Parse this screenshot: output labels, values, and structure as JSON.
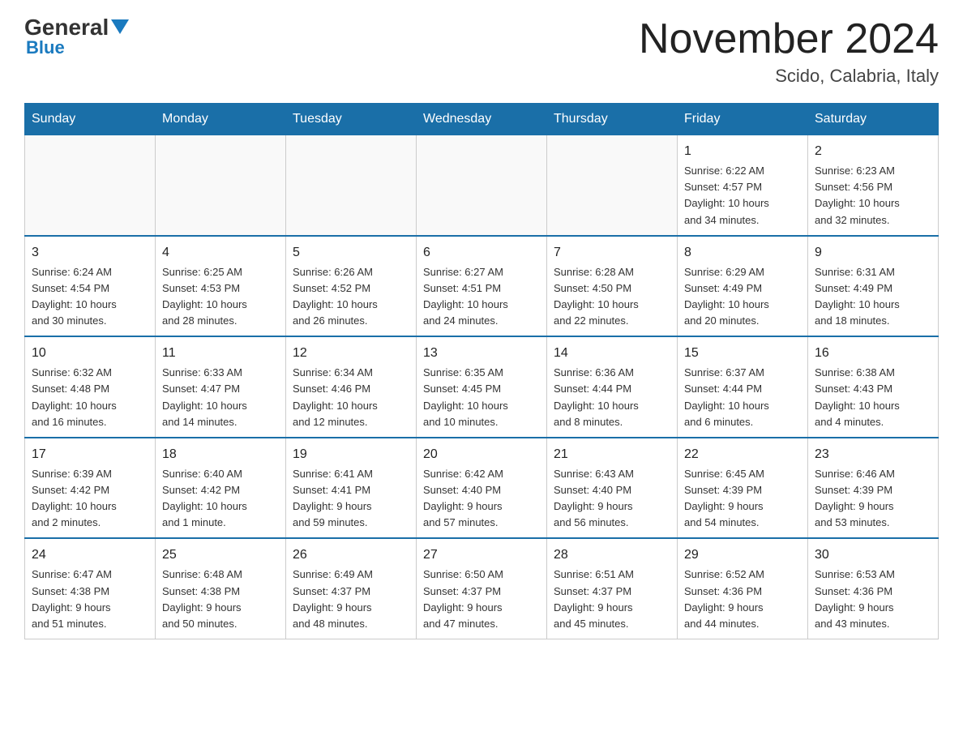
{
  "header": {
    "logo_main": "General",
    "logo_sub": "Blue",
    "month_year": "November 2024",
    "location": "Scido, Calabria, Italy"
  },
  "weekdays": [
    "Sunday",
    "Monday",
    "Tuesday",
    "Wednesday",
    "Thursday",
    "Friday",
    "Saturday"
  ],
  "weeks": [
    [
      {
        "day": "",
        "info": ""
      },
      {
        "day": "",
        "info": ""
      },
      {
        "day": "",
        "info": ""
      },
      {
        "day": "",
        "info": ""
      },
      {
        "day": "",
        "info": ""
      },
      {
        "day": "1",
        "info": "Sunrise: 6:22 AM\nSunset: 4:57 PM\nDaylight: 10 hours\nand 34 minutes."
      },
      {
        "day": "2",
        "info": "Sunrise: 6:23 AM\nSunset: 4:56 PM\nDaylight: 10 hours\nand 32 minutes."
      }
    ],
    [
      {
        "day": "3",
        "info": "Sunrise: 6:24 AM\nSunset: 4:54 PM\nDaylight: 10 hours\nand 30 minutes."
      },
      {
        "day": "4",
        "info": "Sunrise: 6:25 AM\nSunset: 4:53 PM\nDaylight: 10 hours\nand 28 minutes."
      },
      {
        "day": "5",
        "info": "Sunrise: 6:26 AM\nSunset: 4:52 PM\nDaylight: 10 hours\nand 26 minutes."
      },
      {
        "day": "6",
        "info": "Sunrise: 6:27 AM\nSunset: 4:51 PM\nDaylight: 10 hours\nand 24 minutes."
      },
      {
        "day": "7",
        "info": "Sunrise: 6:28 AM\nSunset: 4:50 PM\nDaylight: 10 hours\nand 22 minutes."
      },
      {
        "day": "8",
        "info": "Sunrise: 6:29 AM\nSunset: 4:49 PM\nDaylight: 10 hours\nand 20 minutes."
      },
      {
        "day": "9",
        "info": "Sunrise: 6:31 AM\nSunset: 4:49 PM\nDaylight: 10 hours\nand 18 minutes."
      }
    ],
    [
      {
        "day": "10",
        "info": "Sunrise: 6:32 AM\nSunset: 4:48 PM\nDaylight: 10 hours\nand 16 minutes."
      },
      {
        "day": "11",
        "info": "Sunrise: 6:33 AM\nSunset: 4:47 PM\nDaylight: 10 hours\nand 14 minutes."
      },
      {
        "day": "12",
        "info": "Sunrise: 6:34 AM\nSunset: 4:46 PM\nDaylight: 10 hours\nand 12 minutes."
      },
      {
        "day": "13",
        "info": "Sunrise: 6:35 AM\nSunset: 4:45 PM\nDaylight: 10 hours\nand 10 minutes."
      },
      {
        "day": "14",
        "info": "Sunrise: 6:36 AM\nSunset: 4:44 PM\nDaylight: 10 hours\nand 8 minutes."
      },
      {
        "day": "15",
        "info": "Sunrise: 6:37 AM\nSunset: 4:44 PM\nDaylight: 10 hours\nand 6 minutes."
      },
      {
        "day": "16",
        "info": "Sunrise: 6:38 AM\nSunset: 4:43 PM\nDaylight: 10 hours\nand 4 minutes."
      }
    ],
    [
      {
        "day": "17",
        "info": "Sunrise: 6:39 AM\nSunset: 4:42 PM\nDaylight: 10 hours\nand 2 minutes."
      },
      {
        "day": "18",
        "info": "Sunrise: 6:40 AM\nSunset: 4:42 PM\nDaylight: 10 hours\nand 1 minute."
      },
      {
        "day": "19",
        "info": "Sunrise: 6:41 AM\nSunset: 4:41 PM\nDaylight: 9 hours\nand 59 minutes."
      },
      {
        "day": "20",
        "info": "Sunrise: 6:42 AM\nSunset: 4:40 PM\nDaylight: 9 hours\nand 57 minutes."
      },
      {
        "day": "21",
        "info": "Sunrise: 6:43 AM\nSunset: 4:40 PM\nDaylight: 9 hours\nand 56 minutes."
      },
      {
        "day": "22",
        "info": "Sunrise: 6:45 AM\nSunset: 4:39 PM\nDaylight: 9 hours\nand 54 minutes."
      },
      {
        "day": "23",
        "info": "Sunrise: 6:46 AM\nSunset: 4:39 PM\nDaylight: 9 hours\nand 53 minutes."
      }
    ],
    [
      {
        "day": "24",
        "info": "Sunrise: 6:47 AM\nSunset: 4:38 PM\nDaylight: 9 hours\nand 51 minutes."
      },
      {
        "day": "25",
        "info": "Sunrise: 6:48 AM\nSunset: 4:38 PM\nDaylight: 9 hours\nand 50 minutes."
      },
      {
        "day": "26",
        "info": "Sunrise: 6:49 AM\nSunset: 4:37 PM\nDaylight: 9 hours\nand 48 minutes."
      },
      {
        "day": "27",
        "info": "Sunrise: 6:50 AM\nSunset: 4:37 PM\nDaylight: 9 hours\nand 47 minutes."
      },
      {
        "day": "28",
        "info": "Sunrise: 6:51 AM\nSunset: 4:37 PM\nDaylight: 9 hours\nand 45 minutes."
      },
      {
        "day": "29",
        "info": "Sunrise: 6:52 AM\nSunset: 4:36 PM\nDaylight: 9 hours\nand 44 minutes."
      },
      {
        "day": "30",
        "info": "Sunrise: 6:53 AM\nSunset: 4:36 PM\nDaylight: 9 hours\nand 43 minutes."
      }
    ]
  ]
}
